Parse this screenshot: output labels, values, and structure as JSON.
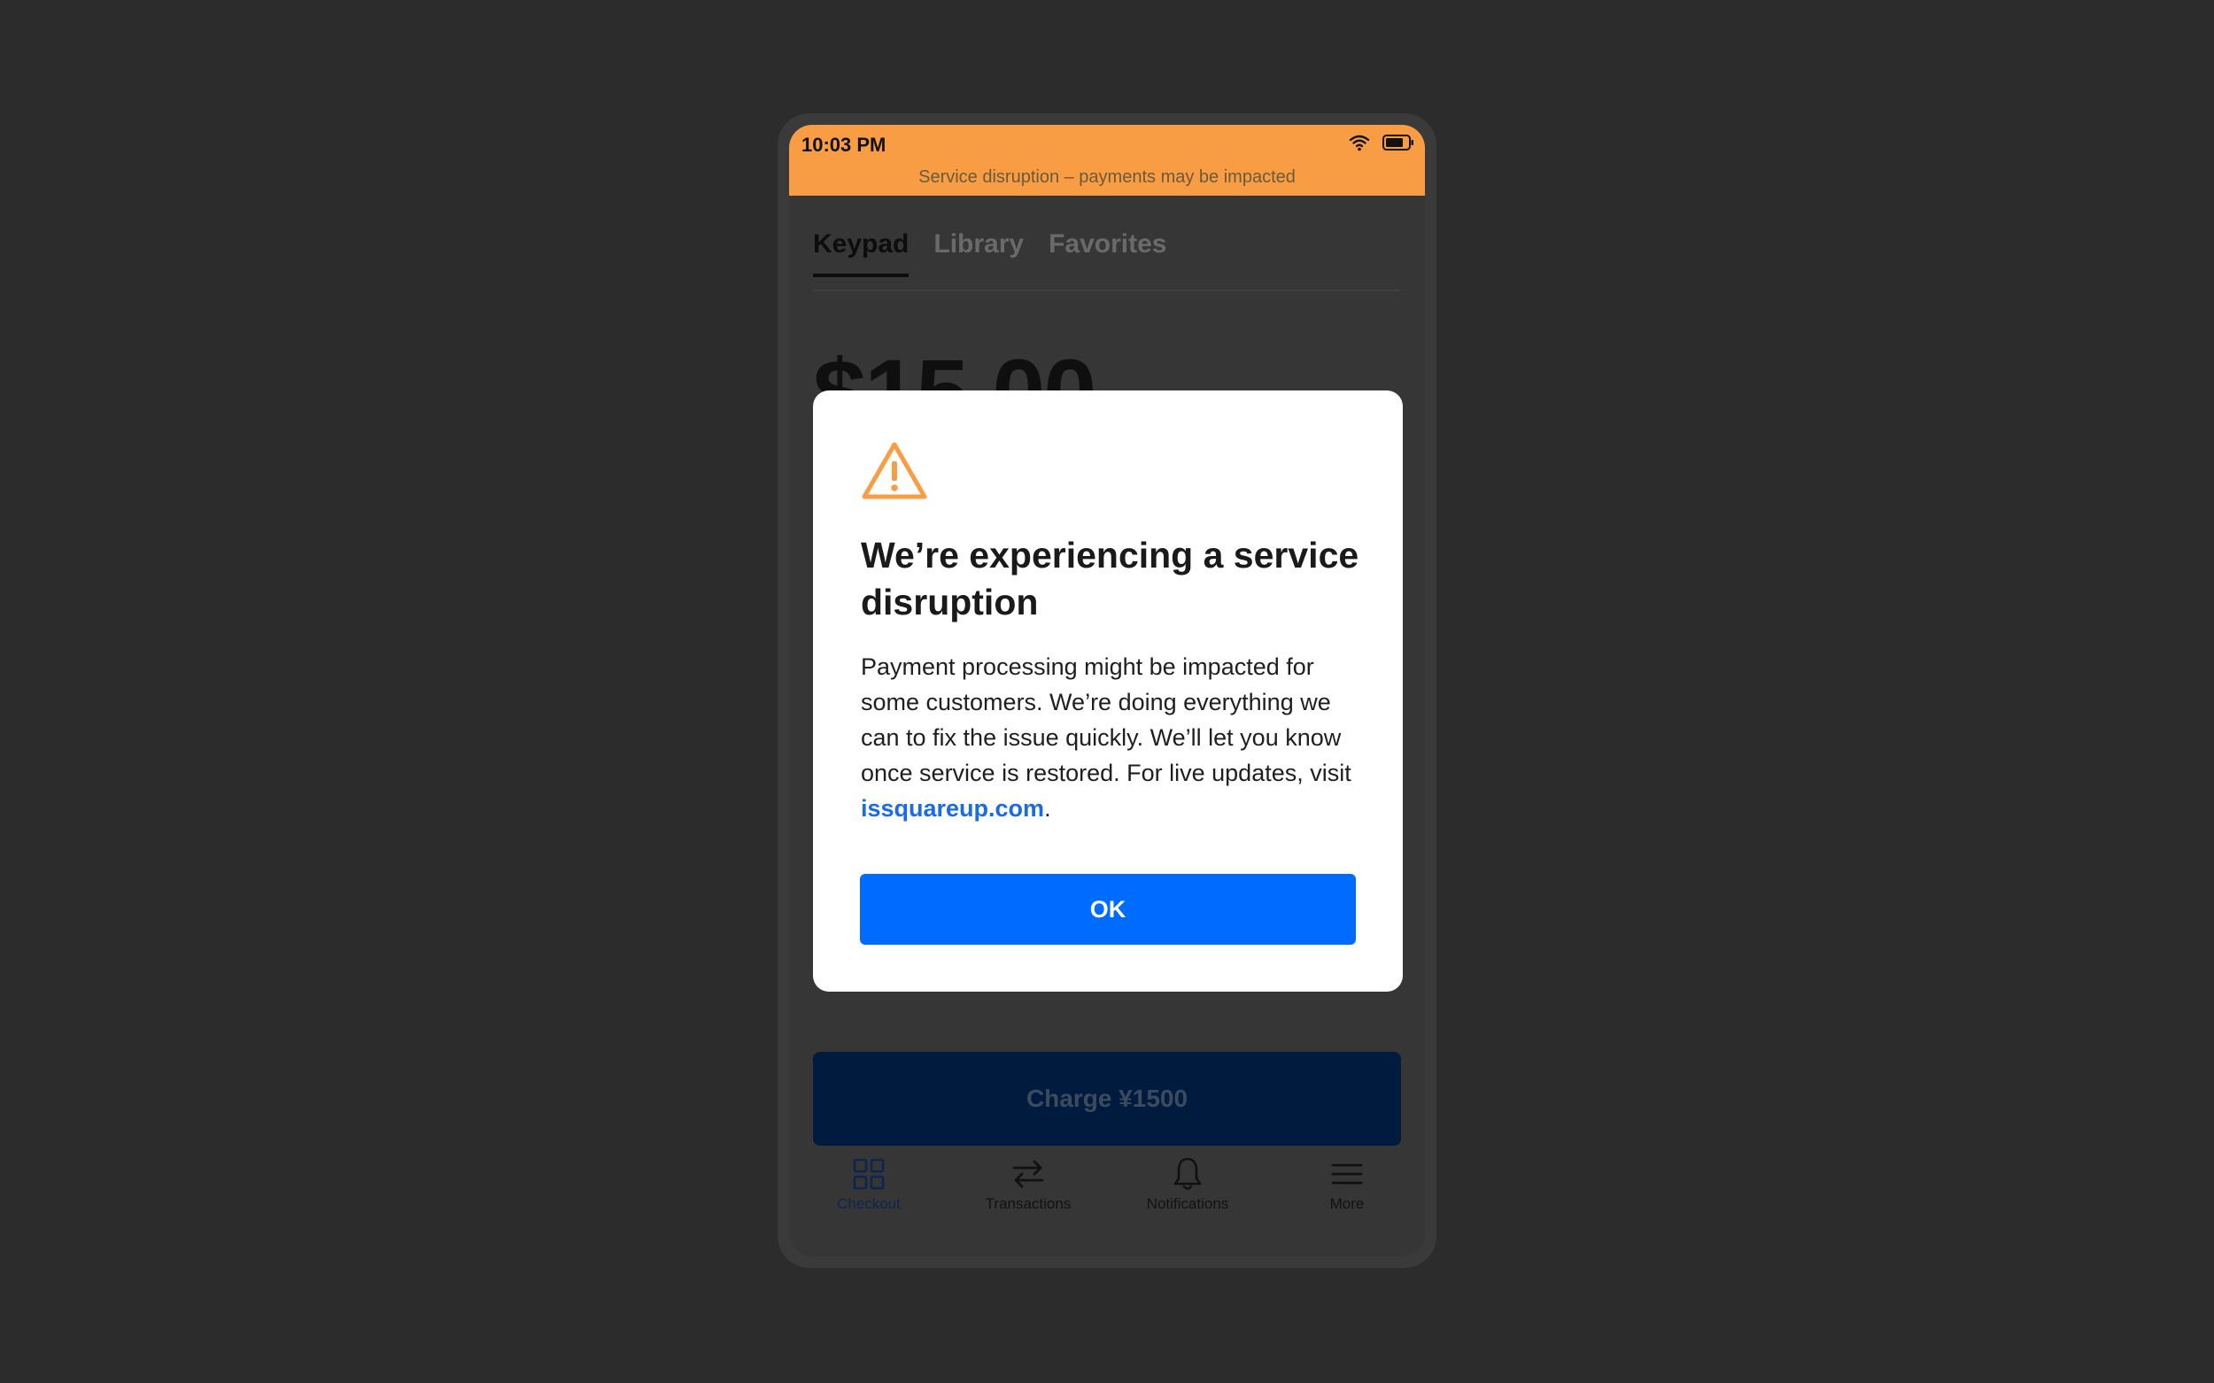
{
  "status_bar": {
    "time": "10:03 PM",
    "wifi_icon": "wifi-icon",
    "battery_icon": "battery-icon"
  },
  "banner": {
    "message": "Service disruption – payments may be impacted",
    "color": "#f99d45"
  },
  "tabs": [
    {
      "label": "Keypad",
      "active": true
    },
    {
      "label": "Library",
      "active": false
    },
    {
      "label": "Favorites",
      "active": false
    }
  ],
  "amount": "$15.00",
  "charge_button": {
    "label": "Charge ¥1500"
  },
  "bottom_nav": [
    {
      "label": "Checkout",
      "icon": "grid-icon",
      "active": true
    },
    {
      "label": "Transactions",
      "icon": "transfer-arrows-icon",
      "active": false
    },
    {
      "label": "Notifications",
      "icon": "bell-icon",
      "active": false
    },
    {
      "label": "More",
      "icon": "hamburger-menu-icon",
      "active": false
    }
  ],
  "modal": {
    "icon": "warning-icon",
    "title": "We’re experiencing a service disruption",
    "body_text": "Payment processing might be impacted for some customers. We’re doing everything we can to fix the issue quickly. We’ll let you know once service is restored. For live updates, visit",
    "link_text": "issquareup.com",
    "link_suffix": ".",
    "ok_label": "OK",
    "accent_color": "#006bff",
    "warning_color": "#f99d45"
  }
}
